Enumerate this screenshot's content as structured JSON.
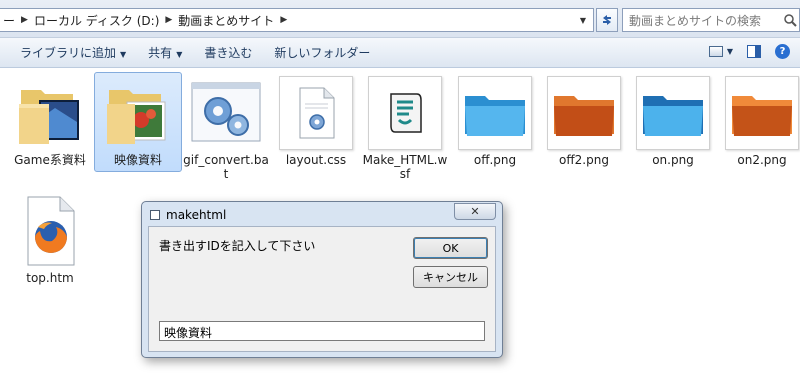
{
  "address": {
    "crumbs": [
      "ローカル ディスク (D:)",
      "動画まとめサイト"
    ],
    "search_placeholder": "動画まとめサイトの検索"
  },
  "toolbar": {
    "library": "ライブラリに追加",
    "share": "共有",
    "burn": "書き込む",
    "new_folder": "新しいフォルダー"
  },
  "files": [
    {
      "name": "Game系資料",
      "icon": "folder-icon"
    },
    {
      "name": "映像資料",
      "icon": "folder-icon",
      "selected": true
    },
    {
      "name": "gif_convert.bat",
      "icon": "batch-file-icon"
    },
    {
      "name": "layout.css",
      "icon": "css-file-icon"
    },
    {
      "name": "Make_HTML.wsf",
      "icon": "script-file-icon"
    },
    {
      "name": "off.png",
      "icon": "blue-folder-image"
    },
    {
      "name": "off2.png",
      "icon": "orange-folder-image"
    },
    {
      "name": "on.png",
      "icon": "blue-folder-image"
    },
    {
      "name": "on2.png",
      "icon": "orange-folder-image"
    },
    {
      "name": "top.htm",
      "icon": "firefox-document-icon"
    }
  ],
  "dialog": {
    "title": "makehtml",
    "prompt": "書き出すIDを記入して下さい",
    "ok_label": "OK",
    "cancel_label": "キャンセル",
    "input_value": "映像資料"
  },
  "colors": {
    "blue_folder": "#45a8e8",
    "orange_folder": "#c7531b",
    "selection": "#c1dcfc"
  }
}
